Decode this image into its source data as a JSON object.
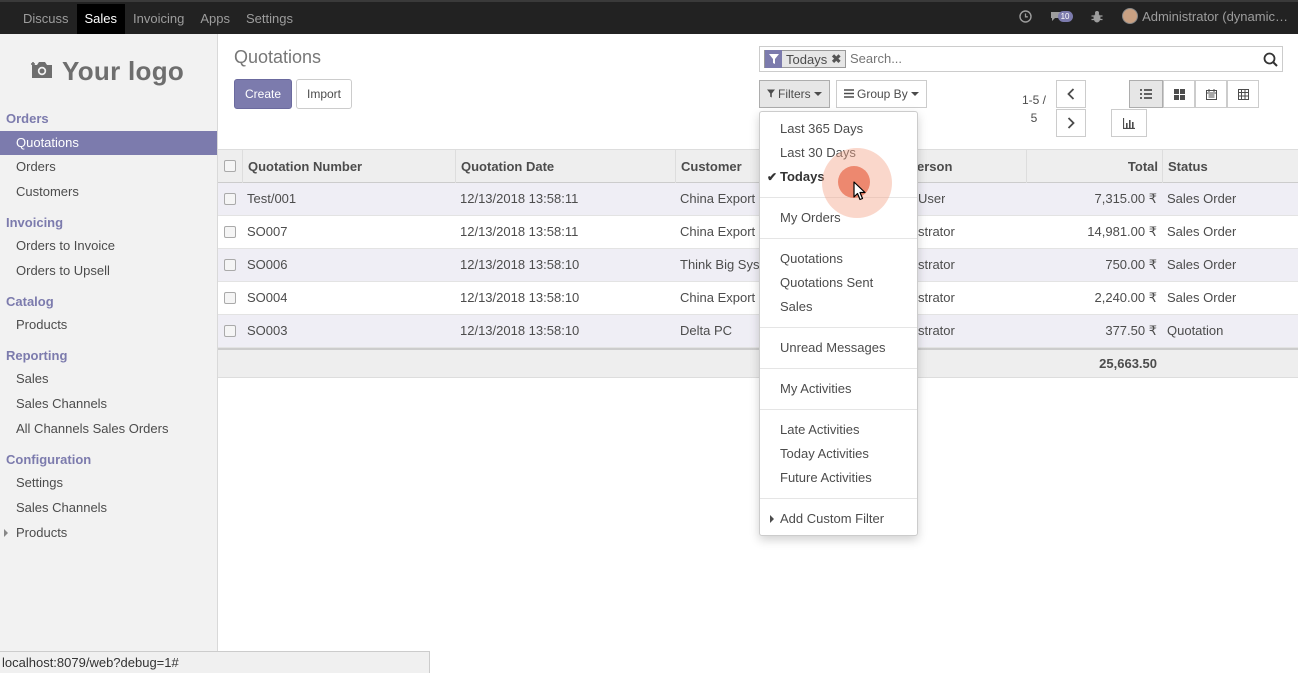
{
  "topbar": {
    "menu": [
      "Discuss",
      "Sales",
      "Invoicing",
      "Apps",
      "Settings"
    ],
    "active": "Sales",
    "icons": [
      "clock-icon",
      "chat-icon",
      "bug-icon"
    ],
    "messages_badge": "10",
    "user": "Administrator (dynamic…"
  },
  "sidebar": {
    "logo_text": "Your logo",
    "sections": [
      {
        "title": "Orders",
        "items": [
          "Quotations",
          "Orders",
          "Customers"
        ]
      },
      {
        "title": "Invoicing",
        "items": [
          "Orders to Invoice",
          "Orders to Upsell"
        ]
      },
      {
        "title": "Catalog",
        "items": [
          "Products"
        ]
      },
      {
        "title": "Reporting",
        "items": [
          "Sales",
          "Sales Channels",
          "All Channels Sales Orders"
        ]
      },
      {
        "title": "Configuration",
        "items": [
          "Settings",
          "Sales Channels",
          "Products"
        ]
      }
    ],
    "active_item": "Quotations"
  },
  "main": {
    "title": "Quotations",
    "create_label": "Create",
    "import_label": "Import",
    "search": {
      "facet": "Todays",
      "placeholder": "Search..."
    },
    "filters_label": "Filters",
    "groupby_label": "Group By",
    "pager": {
      "line1": "1-5 /",
      "line2": "5"
    }
  },
  "table": {
    "headers": [
      "Quotation Number",
      "Quotation Date",
      "Customer",
      "Salesperson",
      "Total",
      "Status"
    ],
    "headers_visible": [
      "Quotation Number",
      "Quotation Date",
      "Customer",
      "erson",
      "Total",
      "Status"
    ],
    "rows": [
      {
        "number": "Test/001",
        "date": "12/13/2018 13:58:11",
        "customer": "China Export",
        "salesperson": "User",
        "total": "7,315.00 ₹",
        "status": "Sales Order"
      },
      {
        "number": "SO007",
        "date": "12/13/2018 13:58:11",
        "customer": "China Export",
        "salesperson": "strator",
        "total": "14,981.00 ₹",
        "status": "Sales Order"
      },
      {
        "number": "SO006",
        "date": "12/13/2018 13:58:10",
        "customer": "Think Big Sys",
        "salesperson": "strator",
        "total": "750.00 ₹",
        "status": "Sales Order"
      },
      {
        "number": "SO004",
        "date": "12/13/2018 13:58:10",
        "customer": "China Export",
        "salesperson": "strator",
        "total": "2,240.00 ₹",
        "status": "Sales Order"
      },
      {
        "number": "SO003",
        "date": "12/13/2018 13:58:10",
        "customer": "Delta PC",
        "salesperson": "strator",
        "total": "377.50 ₹",
        "status": "Quotation"
      }
    ],
    "sum_total": "25,663.50"
  },
  "filters_dropdown": {
    "groups": [
      [
        "Last 365 Days",
        "Last 30 Days",
        "Todays"
      ],
      [
        "My Orders"
      ],
      [
        "Quotations",
        "Quotations Sent",
        "Sales"
      ],
      [
        "Unread Messages"
      ],
      [
        "My Activities"
      ],
      [
        "Late Activities",
        "Today Activities",
        "Future Activities"
      ],
      [
        "Add Custom Filter"
      ]
    ],
    "checked": "Todays"
  },
  "statusbar": "localhost:8079/web?debug=1#",
  "colors": {
    "accent": "#7c7bad",
    "topbar": "#222222"
  }
}
